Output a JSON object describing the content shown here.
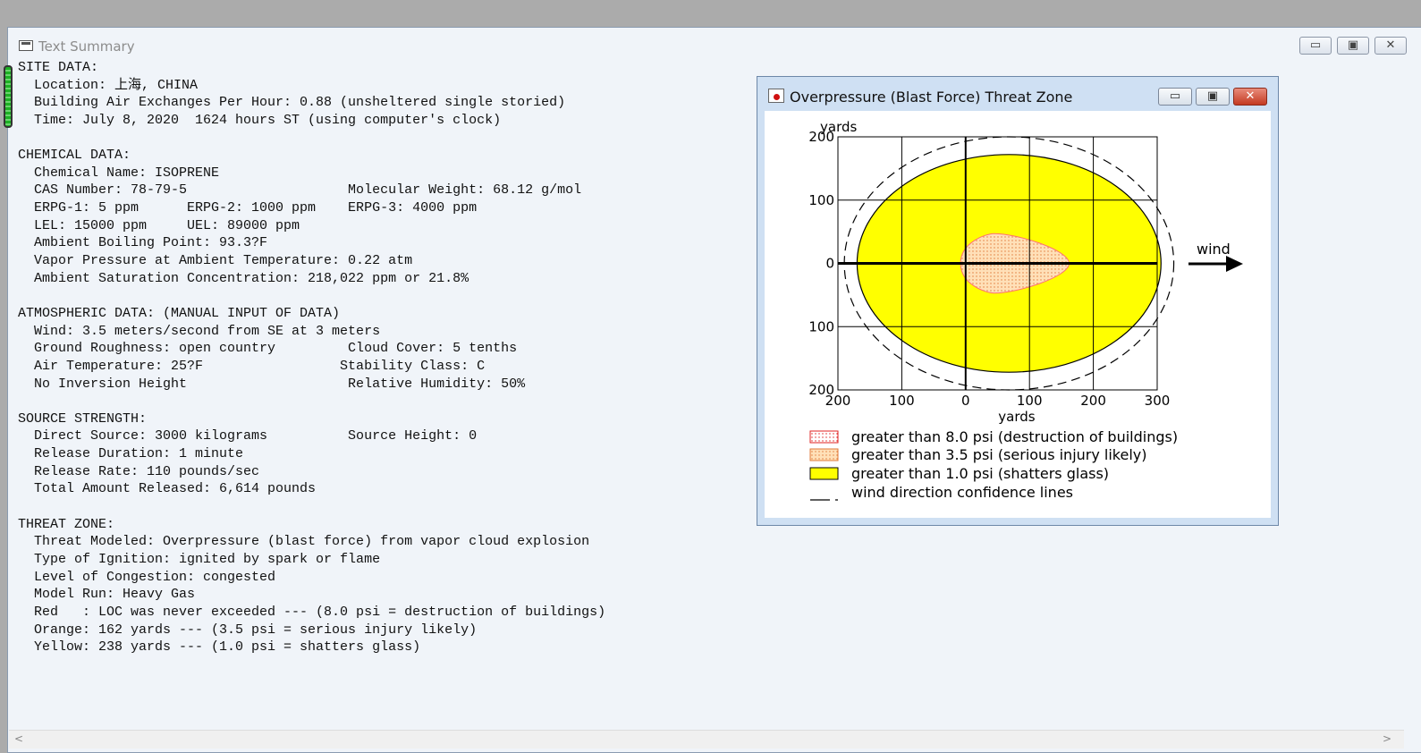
{
  "main_window": {
    "title": "Text Summary",
    "buttons": {
      "minimize": "▭",
      "maximize": "▣",
      "close": "✕"
    }
  },
  "summary_lines": [
    "SITE DATA:",
    "  Location: 上海, CHINA",
    "  Building Air Exchanges Per Hour: 0.88 (unsheltered single storied)",
    "  Time: July 8, 2020  1624 hours ST (using computer's clock)",
    "",
    "CHEMICAL DATA:",
    "  Chemical Name: ISOPRENE",
    "  CAS Number: 78-79-5                    Molecular Weight: 68.12 g/mol",
    "  ERPG-1: 5 ppm      ERPG-2: 1000 ppm    ERPG-3: 4000 ppm",
    "  LEL: 15000 ppm     UEL: 89000 ppm",
    "  Ambient Boiling Point: 93.3?F",
    "  Vapor Pressure at Ambient Temperature: 0.22 atm",
    "  Ambient Saturation Concentration: 218,022 ppm or 21.8%",
    "",
    "ATMOSPHERIC DATA: (MANUAL INPUT OF DATA)",
    "  Wind: 3.5 meters/second from SE at 3 meters",
    "  Ground Roughness: open country         Cloud Cover: 5 tenths",
    "  Air Temperature: 25?F                 Stability Class: C",
    "  No Inversion Height                    Relative Humidity: 50%",
    "",
    "SOURCE STRENGTH:",
    "  Direct Source: 3000 kilograms          Source Height: 0",
    "  Release Duration: 1 minute",
    "  Release Rate: 110 pounds/sec",
    "  Total Amount Released: 6,614 pounds",
    "",
    "THREAT ZONE:",
    "  Threat Modeled: Overpressure (blast force) from vapor cloud explosion",
    "  Type of Ignition: ignited by spark or flame",
    "  Level of Congestion: congested",
    "  Model Run: Heavy Gas",
    "  Red   : LOC was never exceeded --- (8.0 psi = destruction of buildings)",
    "  Orange: 162 yards --- (3.5 psi = serious injury likely)",
    "  Yellow: 238 yards --- (1.0 psi = shatters glass)"
  ],
  "threat_window": {
    "title": "Overpressure (Blast Force) Threat Zone",
    "buttons": {
      "minimize": "▭",
      "maximize": "▣",
      "close": "✕"
    }
  },
  "chart_data": {
    "type": "scatter",
    "xlabel": "yards",
    "ylabel": "yards",
    "xlim": [
      -200,
      300
    ],
    "ylim": [
      -200,
      200
    ],
    "x_tick_labels": [
      "200",
      "100",
      "0",
      "100",
      "200",
      "300"
    ],
    "y_tick_labels": [
      "200",
      "100",
      "0",
      "100",
      "200"
    ],
    "wind_label": "wind",
    "zones": [
      {
        "name": "greater than 1.0 psi (shatters glass)",
        "color": "#ffff00",
        "center_x": 68,
        "center_y": 0,
        "radius_x": 238,
        "radius_y": 172
      },
      {
        "name": "greater than 3.5 psi (serious injury likely)",
        "color": "#ffe0b8",
        "x_min": -8,
        "x_max": 162,
        "y_max": 47
      },
      {
        "name": "greater than 8.0 psi (destruction of buildings)",
        "color": "#ffffff",
        "extent": 0
      }
    ],
    "legend": [
      {
        "label": "greater than 8.0 psi (destruction of buildings)",
        "swatch": "red-dotted"
      },
      {
        "label": "greater than 3.5 psi (serious injury likely)",
        "swatch": "orange-dotted"
      },
      {
        "label": "greater than 1.0 psi (shatters glass)",
        "swatch": "yellow"
      },
      {
        "label": "wind direction confidence lines",
        "swatch": "dash"
      }
    ]
  },
  "scrollbar": {
    "left_arrow": "<",
    "right_arrow": ">"
  }
}
